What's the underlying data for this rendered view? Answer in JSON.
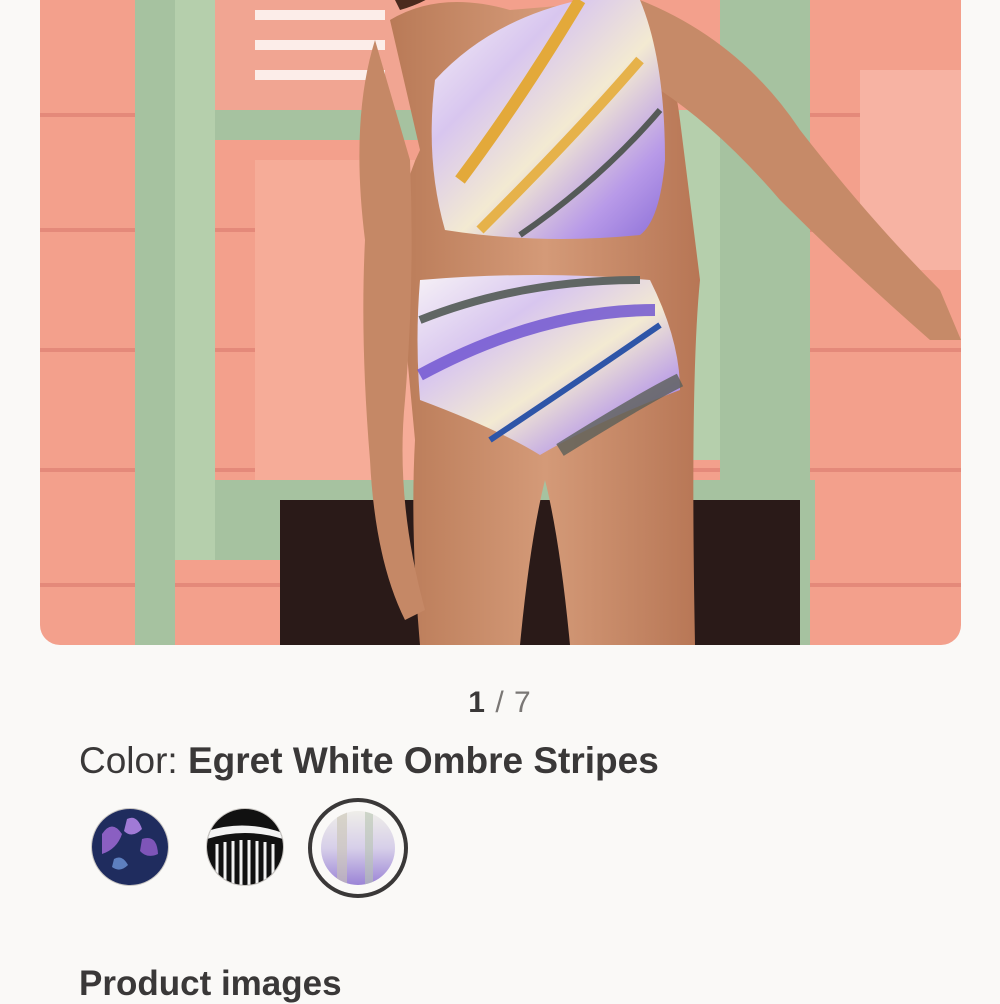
{
  "gallery": {
    "current_page": "1",
    "separator": "/",
    "total_pages": "7",
    "image_description_icon": "product-photo"
  },
  "color_selector": {
    "label": "Color:",
    "selected_value": "Egret White Ombre Stripes",
    "swatches": [
      {
        "name": "navy-floral",
        "colors": [
          "#1f2c5e",
          "#8a5fc2"
        ]
      },
      {
        "name": "black-white-stripe",
        "colors": [
          "#111111",
          "#f2f2f2"
        ]
      },
      {
        "name": "egret-white-ombre",
        "colors": [
          "#efeee9",
          "#9b84d6"
        ],
        "selected": true
      }
    ]
  },
  "section": {
    "title": "Product images"
  },
  "colors": {
    "background": "#faf9f7",
    "text": "#3a3838",
    "muted": "#7a7775",
    "wall_pink": "#f3a08c",
    "door_green": "#a6c2a0"
  }
}
